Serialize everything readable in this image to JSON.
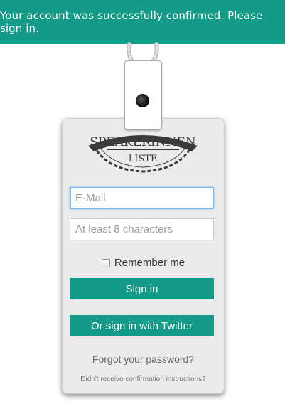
{
  "banner": {
    "message": "Your account was successfully confirmed. Please sign in."
  },
  "logo": {
    "line1": "SPEAKERINNEN",
    "line2": "LISTE"
  },
  "form": {
    "email_placeholder": "E-Mail",
    "password_placeholder": "At least 8 characters",
    "remember_label": "Remember me",
    "signin_label": "Sign in",
    "twitter_label": "Or sign in with Twitter",
    "forgot_label": "Forgot your password?",
    "confirm_label": "Didn't receive confirmation instructions?"
  },
  "colors": {
    "accent": "#149a88",
    "card": "#ebebeb",
    "focus": "#80b8ec"
  },
  "icons": {
    "lanyard": "lanyard-icon",
    "clip": "badge-clip-icon"
  }
}
